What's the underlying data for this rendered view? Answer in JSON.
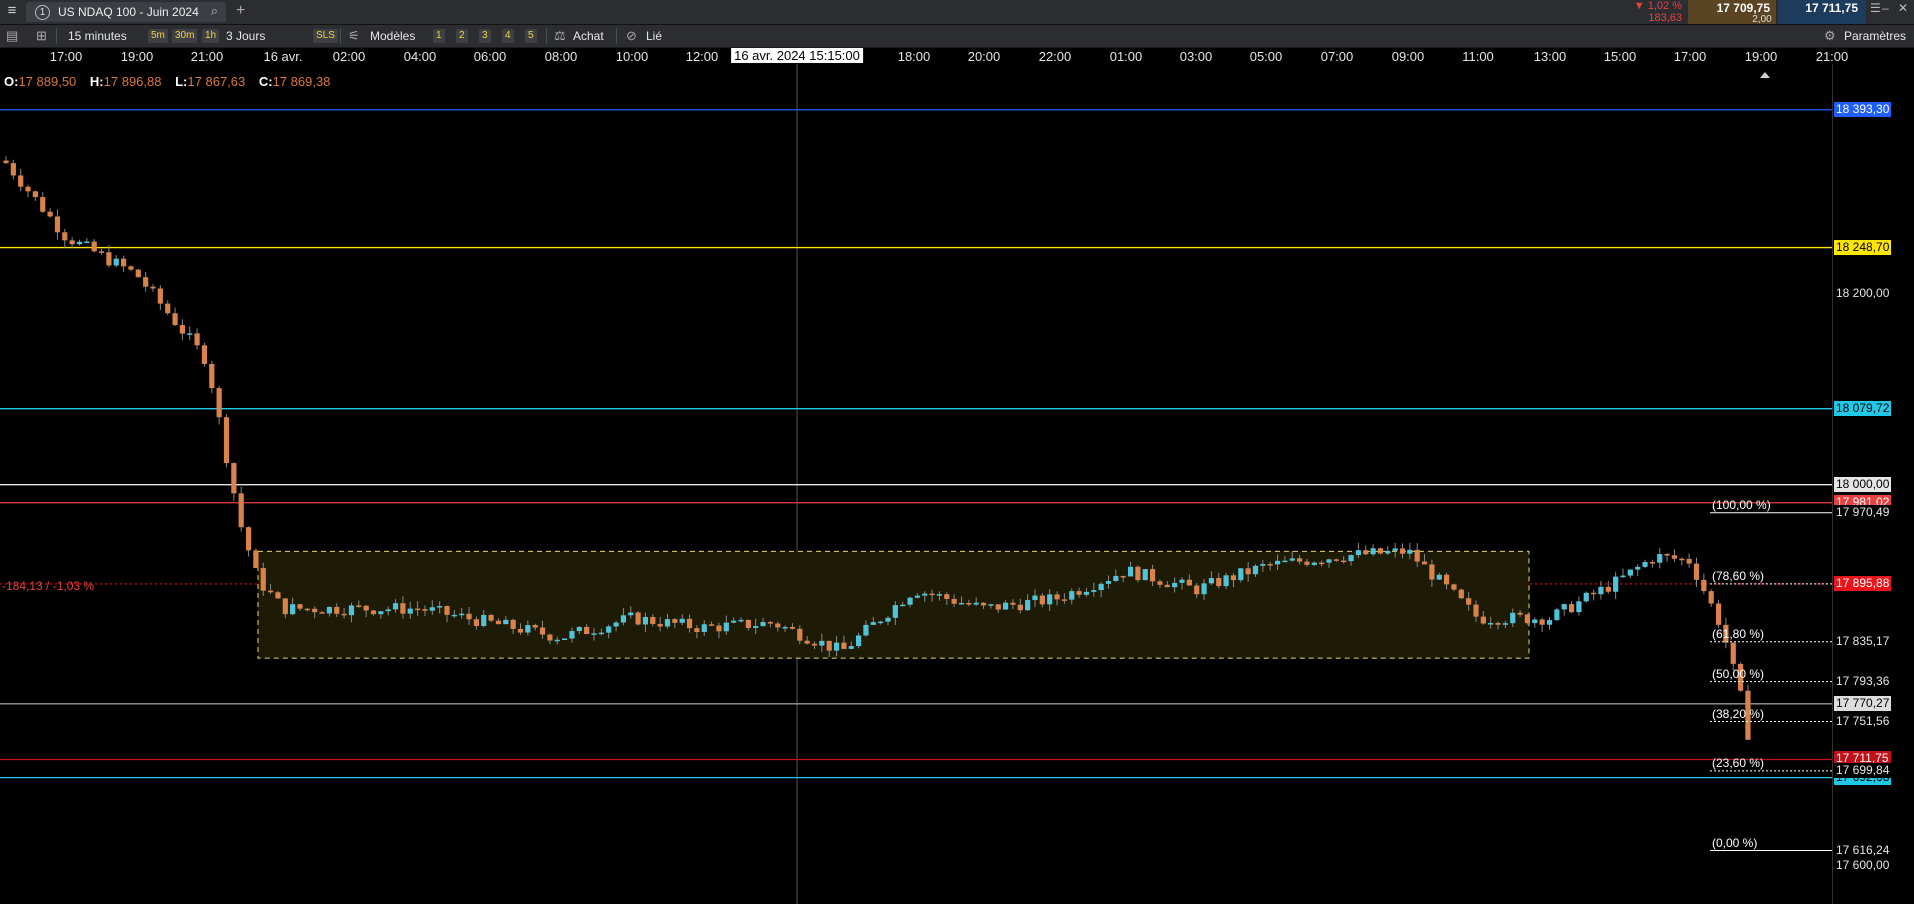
{
  "tab": {
    "number": "1",
    "title": "US NDAQ 100 - Juin 2024"
  },
  "quote": {
    "change_pct": "▼ 1,02 %",
    "change_pts": "183,63",
    "bid": "17 709,75",
    "ask": "17 711,75",
    "spread": "2,00"
  },
  "toolbar": {
    "interval": "15 minutes",
    "quick_intervals": [
      "5m",
      "30m",
      "1h"
    ],
    "range": "3 Jours",
    "sls": "SLS",
    "templates": "Modèles",
    "slots": [
      "1",
      "2",
      "3",
      "4",
      "5"
    ],
    "buy": "Achat",
    "linked": "Lié",
    "settings": "Paramètres"
  },
  "time_axis": {
    "labels": [
      "17:00",
      "19:00",
      "21:00",
      "16 avr.",
      "02:00",
      "04:00",
      "06:00",
      "08:00",
      "10:00",
      "12:00",
      "18:00",
      "20:00",
      "22:00",
      "01:00",
      "03:00",
      "05:00",
      "07:00",
      "09:00",
      "11:00",
      "13:00",
      "15:00",
      "17:00",
      "19:00",
      "21:00"
    ],
    "crosshair_label": "16 avr. 2024 15:15:00"
  },
  "ohlc": {
    "o_key": "O:",
    "o": "17 889,50",
    "h_key": "H:",
    "h": "17 896,88",
    "l_key": "L:",
    "l": "17 867,63",
    "c_key": "C:",
    "c": "17 869,38"
  },
  "change_label": "-184,13 / -1,03 %",
  "price_axis": {
    "ticks": [
      "18 200,00",
      "17 600,00"
    ],
    "levels": [
      {
        "value": "18 393,30",
        "price": 18393.3,
        "color": "#1f5fff",
        "text_color": "#ffffff"
      },
      {
        "value": "18 248,70",
        "price": 18248.7,
        "color": "#ffe600",
        "text_color": "#000000"
      },
      {
        "value": "18 079,72",
        "price": 18079.72,
        "color": "#1ec8e6",
        "text_color": "#000000"
      },
      {
        "value": "18 000,00",
        "price": 18000.0,
        "color": "#e6e6e6",
        "text_color": "#000000"
      },
      {
        "value": "17 981,02",
        "price": 17981.02,
        "color": "#e8413f",
        "text_color": "#ffffff"
      },
      {
        "value": "17 895,88",
        "price": 17895.88,
        "color": "#e8131b",
        "text_color": "#ffffff"
      },
      {
        "value": "17 770,27",
        "price": 17770.27,
        "color": "#dddddd",
        "text_color": "#000000"
      },
      {
        "value": "17 711,75",
        "price": 17711.75,
        "color": "#c0101a",
        "text_color": "#ffffff"
      },
      {
        "value": "17 692,68",
        "price": 17692.68,
        "color": "#1ec8e6",
        "text_color": "#000000"
      }
    ]
  },
  "fibonacci": {
    "levels": [
      {
        "label": "(100,00 %)",
        "value": "17 970,49",
        "price": 17970.49
      },
      {
        "label": "(78,60 %)",
        "value": "17 895,88",
        "price": 17895.88
      },
      {
        "label": "(61,80 %)",
        "value": "17 835,17",
        "price": 17835.17
      },
      {
        "label": "(50,00 %)",
        "value": "17 793,36",
        "price": 17793.36
      },
      {
        "label": "(38,20 %)",
        "value": "17 751,56",
        "price": 17751.56
      },
      {
        "label": "(23,60 %)",
        "value": "17 699,84",
        "price": 17699.84
      },
      {
        "label": "(0,00 %)",
        "value": "17 616,24",
        "price": 17616.24
      }
    ]
  },
  "colors": {
    "bull": "#4fc3d9",
    "bear": "#d9834a",
    "background": "#000000",
    "range_box": "#e6d96a"
  },
  "chart_data": {
    "type": "candlestick",
    "title": "",
    "instrument": "US NDAQ 100 - Juin 2024",
    "interval": "15 minutes",
    "close_path": [
      {
        "t": "15/04 16:00",
        "c": 18340
      },
      {
        "t": "15/04 17:00",
        "c": 18260
      },
      {
        "t": "15/04 18:00",
        "c": 18220
      },
      {
        "t": "15/04 19:00",
        "c": 18130
      },
      {
        "t": "15/04 20:00",
        "c": 17960
      },
      {
        "t": "15/04 21:00",
        "c": 17900
      },
      {
        "t": "15/04 22:00",
        "c": 17870
      },
      {
        "t": "16/04 02:00",
        "c": 17870
      },
      {
        "t": "16/04 04:00",
        "c": 17840
      },
      {
        "t": "16/04 06:00",
        "c": 17860
      },
      {
        "t": "16/04 08:00",
        "c": 17850
      },
      {
        "t": "16/04 10:00",
        "c": 17855
      },
      {
        "t": "16/04 12:00",
        "c": 17825
      },
      {
        "t": "16/04 14:00",
        "c": 17890
      },
      {
        "t": "16/04 16:00",
        "c": 17870
      },
      {
        "t": "16/04 18:00",
        "c": 17880
      },
      {
        "t": "16/04 20:00",
        "c": 17910
      },
      {
        "t": "16/04 22:00",
        "c": 17890
      },
      {
        "t": "17/04 01:00",
        "c": 17915
      },
      {
        "t": "17/04 03:00",
        "c": 17925
      },
      {
        "t": "17/04 05:00",
        "c": 17930
      },
      {
        "t": "17/04 07:00",
        "c": 17860
      },
      {
        "t": "17/04 09:00",
        "c": 17860
      },
      {
        "t": "17/04 11:00",
        "c": 17900
      },
      {
        "t": "17/04 13:00",
        "c": 17925
      },
      {
        "t": "17/04 15:00",
        "c": 17920
      },
      {
        "t": "17/04 16:00",
        "c": 17850
      },
      {
        "t": "17/04 17:00",
        "c": 17760
      },
      {
        "t": "17/04 18:00",
        "c": 17640
      },
      {
        "t": "17/04 19:00",
        "c": 17711.75
      }
    ],
    "range_box": {
      "from": "16/04 00:00",
      "to": "17/04 12:00",
      "high": 17930,
      "low": 17818
    },
    "ylim": [
      17580,
      18430
    ]
  }
}
